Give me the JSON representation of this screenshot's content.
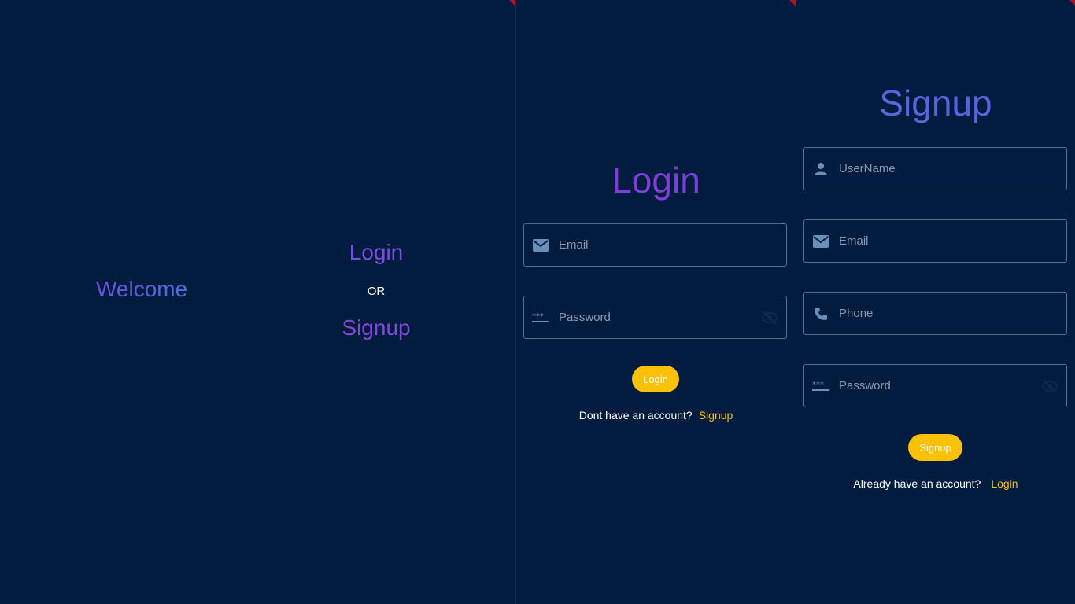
{
  "colors": {
    "background": "#021c3f",
    "accent": "#fbc108",
    "heading": "#7e3fd6",
    "field_border": "#5a6d8a",
    "icon": "#6a8fb8"
  },
  "home": {
    "welcome": "Welcome",
    "login": "Login",
    "or": "OR",
    "signup": "Signup"
  },
  "login_page": {
    "title": "Login",
    "email_placeholder": "Email",
    "password_placeholder": "Password",
    "button": "Login",
    "prompt": "Dont have an account?",
    "switch_link": "Signup",
    "icons": [
      "mail-icon",
      "password-icon",
      "visibility-off-icon"
    ]
  },
  "signup_page": {
    "title": "Signup",
    "username_placeholder": "UserName",
    "email_placeholder": "Email",
    "phone_placeholder": "Phone",
    "password_placeholder": "Password",
    "button": "Signup",
    "prompt": "Already have an account?",
    "switch_link": "Login",
    "icons": [
      "person-icon",
      "mail-icon",
      "phone-icon",
      "password-icon",
      "visibility-off-icon"
    ]
  }
}
